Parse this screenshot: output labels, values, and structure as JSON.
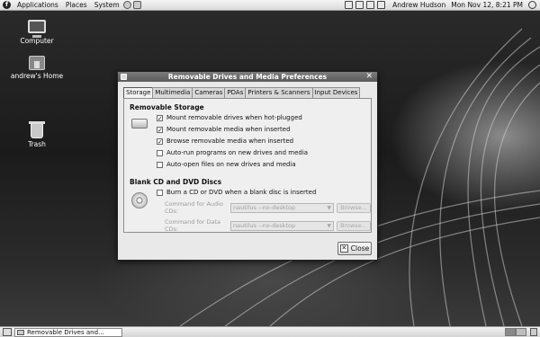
{
  "top_panel": {
    "menus": [
      "Applications",
      "Places",
      "System"
    ],
    "user": "Andrew Hudson",
    "clock": "Mon Nov 12,  8:21 PM"
  },
  "desktop_icons": [
    {
      "label": "Computer"
    },
    {
      "label": "andrew's Home"
    },
    {
      "label": "Trash"
    }
  ],
  "dialog": {
    "title": "Removable Drives and Media Preferences",
    "tabs": [
      "Storage",
      "Multimedia",
      "Cameras",
      "PDAs",
      "Printers & Scanners",
      "Input Devices"
    ],
    "active_tab": "Storage",
    "removable_storage": {
      "heading": "Removable Storage",
      "options": [
        {
          "label": "Mount removable drives when hot-plugged",
          "checked": true
        },
        {
          "label": "Mount removable media when inserted",
          "checked": true
        },
        {
          "label": "Browse removable media when inserted",
          "checked": true
        },
        {
          "label": "Auto-run programs on new drives and media",
          "checked": false
        },
        {
          "label": "Auto-open files on new drives and media",
          "checked": false
        }
      ]
    },
    "blank_discs": {
      "heading": "Blank CD and DVD Discs",
      "burn_option": {
        "label": "Burn a CD or DVD when a blank disc is inserted",
        "checked": false
      },
      "audio_cmd": {
        "label": "Command for Audio CDs:",
        "value": "nautilus --no-desktop",
        "browse": "Browse..."
      },
      "data_cmd": {
        "label": "Command for Data CDs:",
        "value": "nautilus --no-desktop",
        "browse": "Browse..."
      }
    },
    "close_label": "Close"
  },
  "taskbar": {
    "window_button": "Removable Drives and..."
  }
}
